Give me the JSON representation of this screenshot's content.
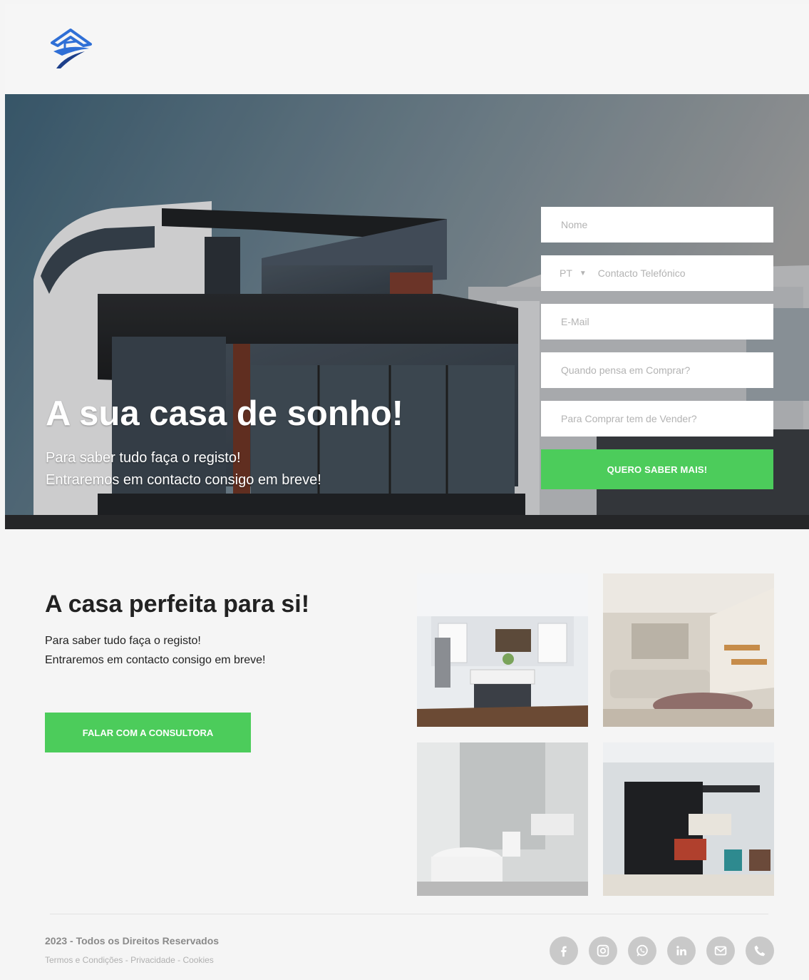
{
  "header": {
    "logo_icon": "house-roof-logo-icon"
  },
  "hero": {
    "title": "A sua casa de sonho!",
    "subtitle_line1": "Para saber tudo faça o registo!",
    "subtitle_line2": "Entraremos em contacto consigo em breve!"
  },
  "form": {
    "name_placeholder": "Nome",
    "phone_country": "PT",
    "phone_placeholder": "Contacto Telefónico",
    "email_placeholder": "E-Mail",
    "when_placeholder": "Quando pensa em Comprar?",
    "sell_placeholder": "Para Comprar tem de Vender?",
    "submit_label": "QUERO SABER MAIS!"
  },
  "section": {
    "title": "A casa perfeita para si!",
    "subtitle_line1": "Para saber tudo faça o registo!",
    "subtitle_line2": "Entraremos em contacto consigo em breve!",
    "button_label": "FALAR COM A CONSULTORA"
  },
  "footer": {
    "copyright": "2023 - Todos os Direitos Reservados",
    "links": [
      "Termos e Condições",
      "Privacidade",
      "Cookies"
    ],
    "separator": " - ",
    "socials": [
      "facebook-icon",
      "instagram-icon",
      "whatsapp-icon",
      "linkedin-icon",
      "email-icon",
      "phone-icon"
    ]
  },
  "colors": {
    "accent": "#4ccc5b",
    "logo": "#2f6fd6",
    "background": "#f5f5f5",
    "icon_gray": "#c9c9c9"
  }
}
